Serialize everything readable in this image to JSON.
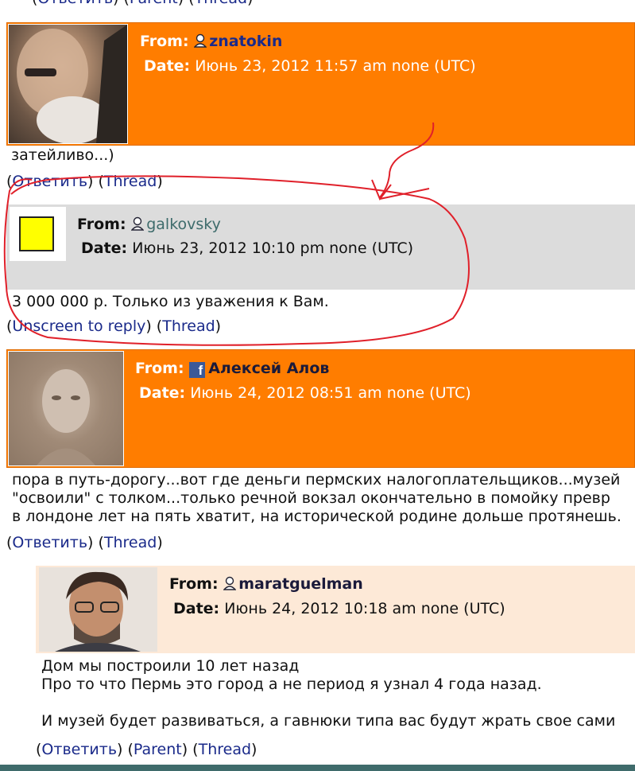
{
  "top_links": {
    "reply": "Ответить",
    "parent": "Parent",
    "thread": "Thread"
  },
  "comments": [
    {
      "from_label": "From:",
      "username": "znatokin",
      "date_label": "Date:",
      "date": "Июнь 23, 2012 11:57 am none (UTC)",
      "body": [
        "затейливо...)"
      ],
      "links": {
        "reply": "Ответить",
        "thread": "Thread"
      }
    },
    {
      "from_label": "From:",
      "username": "galkovsky",
      "date_label": "Date:",
      "date": "Июнь 23, 2012 10:10 pm none (UTC)",
      "body": [
        "3 000 000 р. Только из уважения к Вам."
      ],
      "links": {
        "unscreen": "Unscreen to reply",
        "thread": "Thread"
      }
    },
    {
      "from_label": "From:",
      "username": "Алексей Алов",
      "date_label": "Date:",
      "date": "Июнь 24, 2012 08:51 am none (UTC)",
      "body": [
        "пора в путь-дорогу...вот где деньги пермских налогоплательщиков...музей",
        "\"освоили\" с толком...только речной вокзал окончательно в помойку превр",
        "в лондоне лет на пять хватит, на исторической родине дольше протянешь."
      ],
      "links": {
        "reply": "Ответить",
        "thread": "Thread"
      }
    },
    {
      "from_label": "From:",
      "username": "maratguelman",
      "date_label": "Date:",
      "date": "Июнь 24, 2012 10:18 am none (UTC)",
      "body": [
        "Дом мы построили 10 лет назад",
        "Про то что Пермь это город а не период я узнал 4 года назад.",
        "",
        "И музей будет развиваться, а гавнюки типа вас будут жрать свое сами"
      ],
      "links": {
        "reply": "Ответить",
        "parent": "Parent",
        "thread": "Thread"
      }
    }
  ],
  "colors": {
    "orange_header": "#ff7d00",
    "grey_header": "#dcdcdc",
    "peach_header": "#fde9d7",
    "link": "#1a2a8a",
    "annotation": "#e0202a",
    "bottom_bar": "#3f6b6b"
  },
  "icons": [
    "user-icon",
    "facebook-icon"
  ]
}
